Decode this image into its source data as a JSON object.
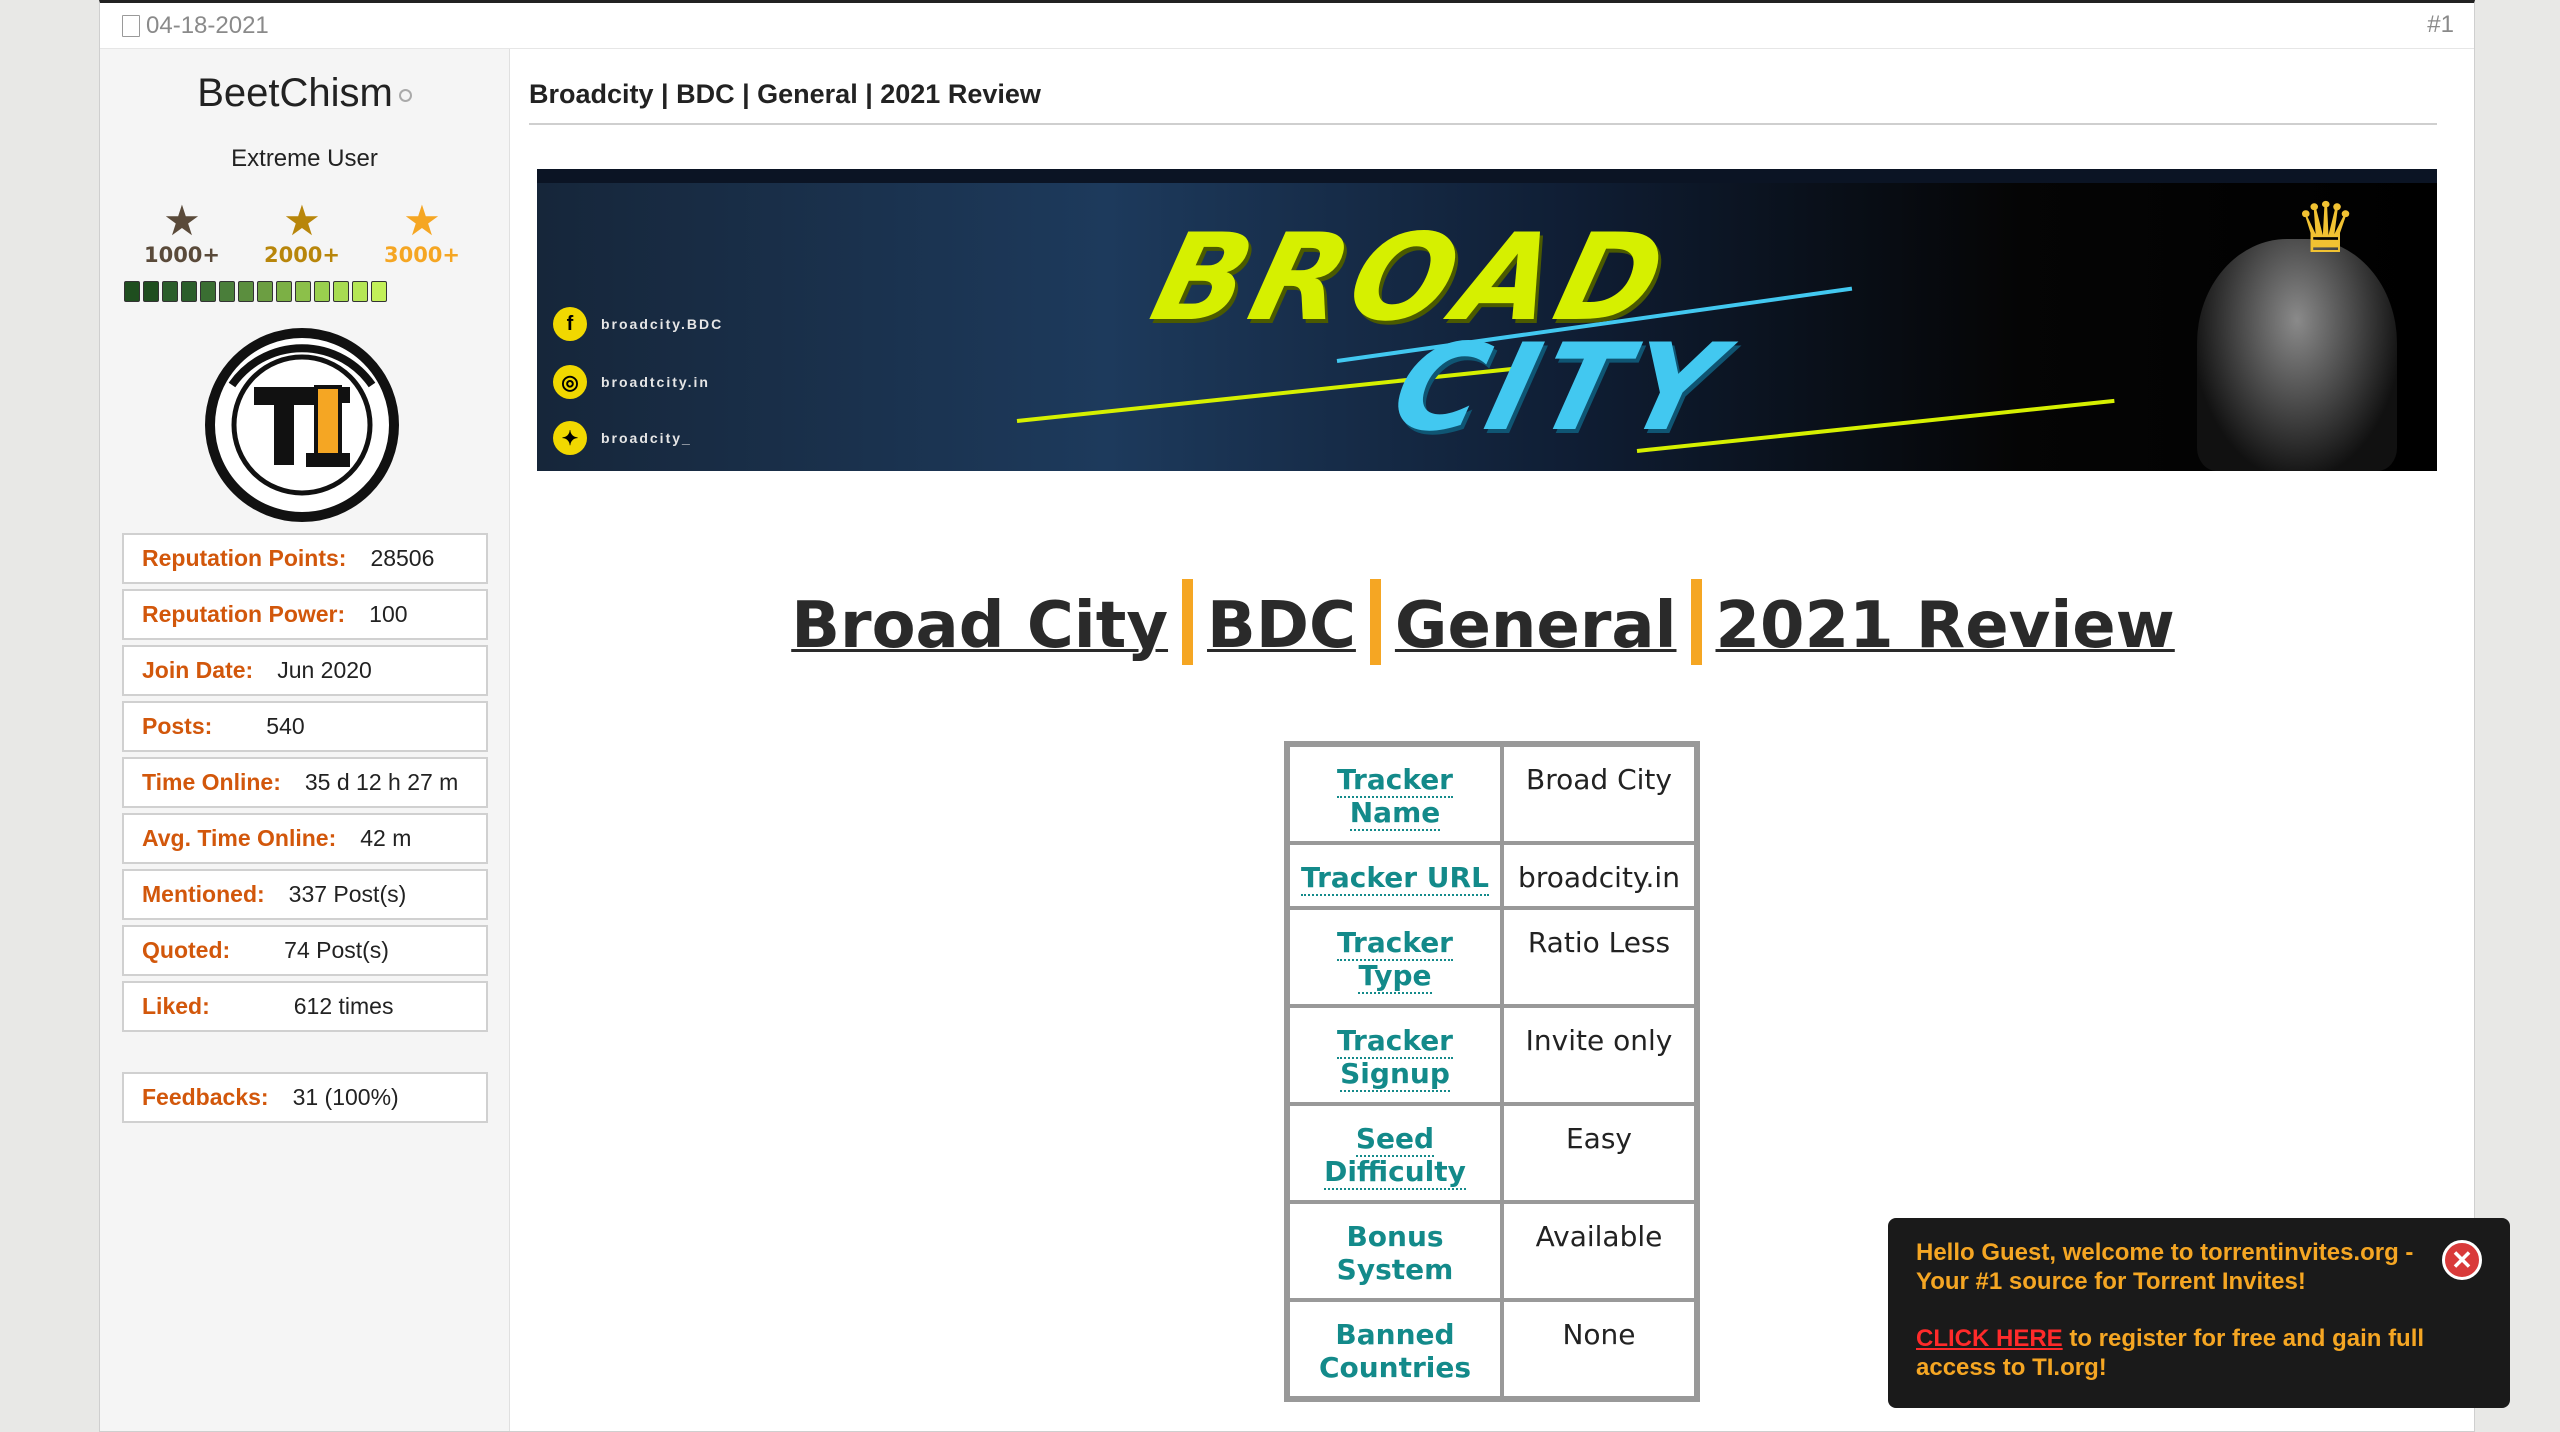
{
  "post": {
    "date": "04-18-2021",
    "number": "#1",
    "title": "Broadcity | BDC | General | 2021 Review"
  },
  "user": {
    "name": "BeetChism",
    "title": "Extreme User",
    "ranks": [
      {
        "label": "1000+",
        "color": "#5a4a3a"
      },
      {
        "label": "2000+",
        "color": "#b8860b"
      },
      {
        "label": "3000+",
        "color": "#f5a623"
      }
    ],
    "rep_bar_colors": [
      "#1f4e1f",
      "#1f4e1f",
      "#2b5e2b",
      "#2b5e2b",
      "#3a6e32",
      "#4a7e3a",
      "#5b8e3e",
      "#6c9e42",
      "#7cb045",
      "#8cc04a",
      "#9ad04e",
      "#a8dc52",
      "#b5e655",
      "#c2f058"
    ],
    "stats": [
      {
        "label": "Reputation Points:",
        "value": "28506"
      },
      {
        "label": "Reputation Power:",
        "value": "100"
      },
      {
        "label": "Join Date:",
        "value": "Jun 2020"
      },
      {
        "label": "Posts:",
        "value": "540"
      },
      {
        "label": "Time Online:",
        "value": "35 d 12 h 27 m"
      },
      {
        "label": "Avg. Time Online:",
        "value": "42 m"
      },
      {
        "label": "Mentioned:",
        "value": "337 Post(s)"
      },
      {
        "label": "Quoted:",
        "value": "74 Post(s)"
      },
      {
        "label": "Liked:",
        "value": "612 times"
      }
    ],
    "feedback": {
      "label": "Feedbacks:",
      "value": "31 (100%)"
    },
    "avatar_text": "TI"
  },
  "banner": {
    "social": [
      {
        "icon": "facebook-icon",
        "glyph": "f",
        "text": "broadcity.BDC"
      },
      {
        "icon": "instagram-icon",
        "glyph": "◎",
        "text": "broadtcity.in"
      },
      {
        "icon": "twitter-icon",
        "glyph": "✦",
        "text": "broadcity_"
      }
    ],
    "word1": "BROAD",
    "word2": "CITY"
  },
  "review": {
    "heading_parts": [
      "Broad City",
      "BDC",
      "General",
      "2021 Review"
    ],
    "accent": "#f5a623",
    "rows": [
      {
        "label": "Tracker Name",
        "value": "Broad City"
      },
      {
        "label": "Tracker URL",
        "value": "broadcity.in"
      },
      {
        "label": "Tracker Type",
        "value": "Ratio Less"
      },
      {
        "label": "Tracker Signup",
        "value": "Invite only"
      },
      {
        "label": "Seed Difficulty",
        "value": "Easy"
      },
      {
        "label": "Bonus System",
        "value": "Available"
      },
      {
        "label": "Banned Countries",
        "value": "None"
      }
    ]
  },
  "toast": {
    "line1": "Hello Guest, welcome to torrentinvites.org - Your #1 source for Torrent Invites!",
    "link": "CLICK HERE",
    "line2": " to register for free and gain full access to TI.org!"
  }
}
